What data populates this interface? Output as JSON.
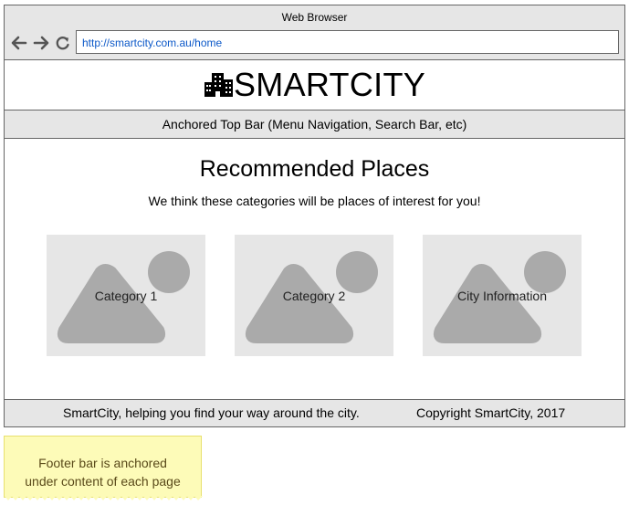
{
  "browser": {
    "title": "Web Browser",
    "url": "http://smartcity.com.au/home"
  },
  "logo": {
    "icon": "city-buildings-icon",
    "text": "SMARTCITY"
  },
  "top_bar": {
    "label": "Anchored Top Bar (Menu Navigation, Search Bar, etc)"
  },
  "main": {
    "title": "Recommended Places",
    "subtitle": "We think these categories will be places of interest for you!",
    "cards": [
      {
        "label": "Category 1",
        "icon": "image-placeholder-icon"
      },
      {
        "label": "Category 2",
        "icon": "image-placeholder-icon"
      },
      {
        "label": "City Information",
        "icon": "image-placeholder-icon"
      }
    ]
  },
  "footer": {
    "tagline": "SmartCity, helping you find your way around the city.",
    "copyright": "Copyright SmartCity, 2017"
  },
  "note": {
    "line1": "Footer bar is anchored",
    "line2": "under content of each page"
  },
  "colors": {
    "chrome": "#e6e6e6",
    "border": "#666666",
    "link": "#0b58c8",
    "placeholder_fill": "#e6e6e6",
    "placeholder_shape": "#aaaaaa",
    "note_bg": "#fdfbb8"
  }
}
